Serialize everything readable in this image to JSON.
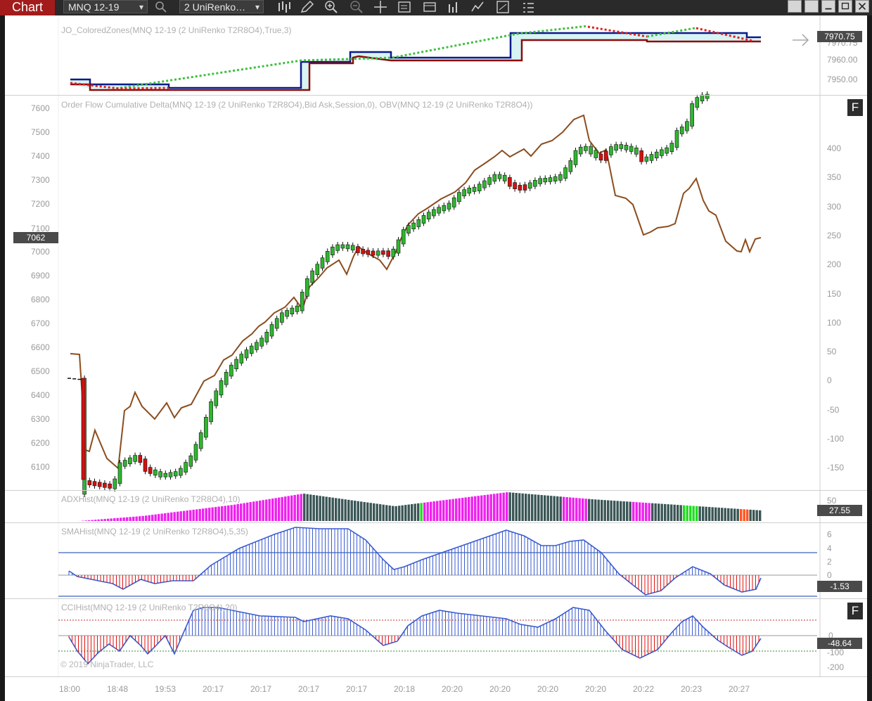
{
  "toolbar": {
    "tab_label": "Chart",
    "instrument": "MNQ 12-19",
    "bar_type": "2 UniRenko…"
  },
  "panels": {
    "zones": {
      "label": "JO_ColoredZones(MNQ 12-19 (2 UniRenko T2R8O4),True,3)",
      "axis_labels": [
        "7970.75",
        "7960.00",
        "7950.00"
      ],
      "price_tag": "7970.75"
    },
    "main": {
      "label": "Order Flow Cumulative Delta(MNQ 12-19 (2 UniRenko T2R8O4),Bid Ask,Session,0), OBV(MNQ 12-19 (2 UniRenko T2R8O4))",
      "left_axis": [
        "7600",
        "7500",
        "7400",
        "7300",
        "7200",
        "7100",
        "7000",
        "6900",
        "6800",
        "6700",
        "6600",
        "6500",
        "6400",
        "6300",
        "6200",
        "6100"
      ],
      "right_axis": [
        "400",
        "350",
        "300",
        "250",
        "200",
        "150",
        "100",
        "50",
        "0",
        "-50",
        "-100",
        "-150"
      ],
      "left_tag": "7062"
    },
    "adx": {
      "label": "ADXHist(MNQ 12-19 (2 UniRenko T2R8O4),10)",
      "tag": "27.55",
      "top_tick": "50"
    },
    "sma": {
      "label": "SMAHist(MNQ 12-19 (2 UniRenko T2R8O4),5,35)",
      "axis": [
        "6",
        "4",
        "2",
        "0"
      ],
      "tag": "-1.53"
    },
    "cci": {
      "label": "CCIHist(MNQ 12-19 (2 UniRenko T2R8O4),20)",
      "axis": [
        "0",
        "-100",
        "-200"
      ],
      "tag": "-48.64"
    }
  },
  "time_axis": [
    "18:00",
    "18:48",
    "19:53",
    "20:17",
    "20:17",
    "20:17",
    "20:17",
    "20:18",
    "20:20",
    "20:20",
    "20:20",
    "20:20",
    "20:22",
    "20:23",
    "20:27"
  ],
  "copyright": "© 2019 NinjaTrader, LLC",
  "f_button": "F",
  "colors": {
    "tab": "#a31b1b",
    "up_candle": "#2fb52f",
    "down_candle": "#d41010",
    "obv_line": "#8b4d1e",
    "zone_blue": "#0a1a8a",
    "zone_red": "#8a0b0b",
    "adx_magenta": "#ee22ee",
    "adx_dark": "#3b5656",
    "sma_blue": "#3a5bd0",
    "hist_red": "#dd1111"
  }
}
